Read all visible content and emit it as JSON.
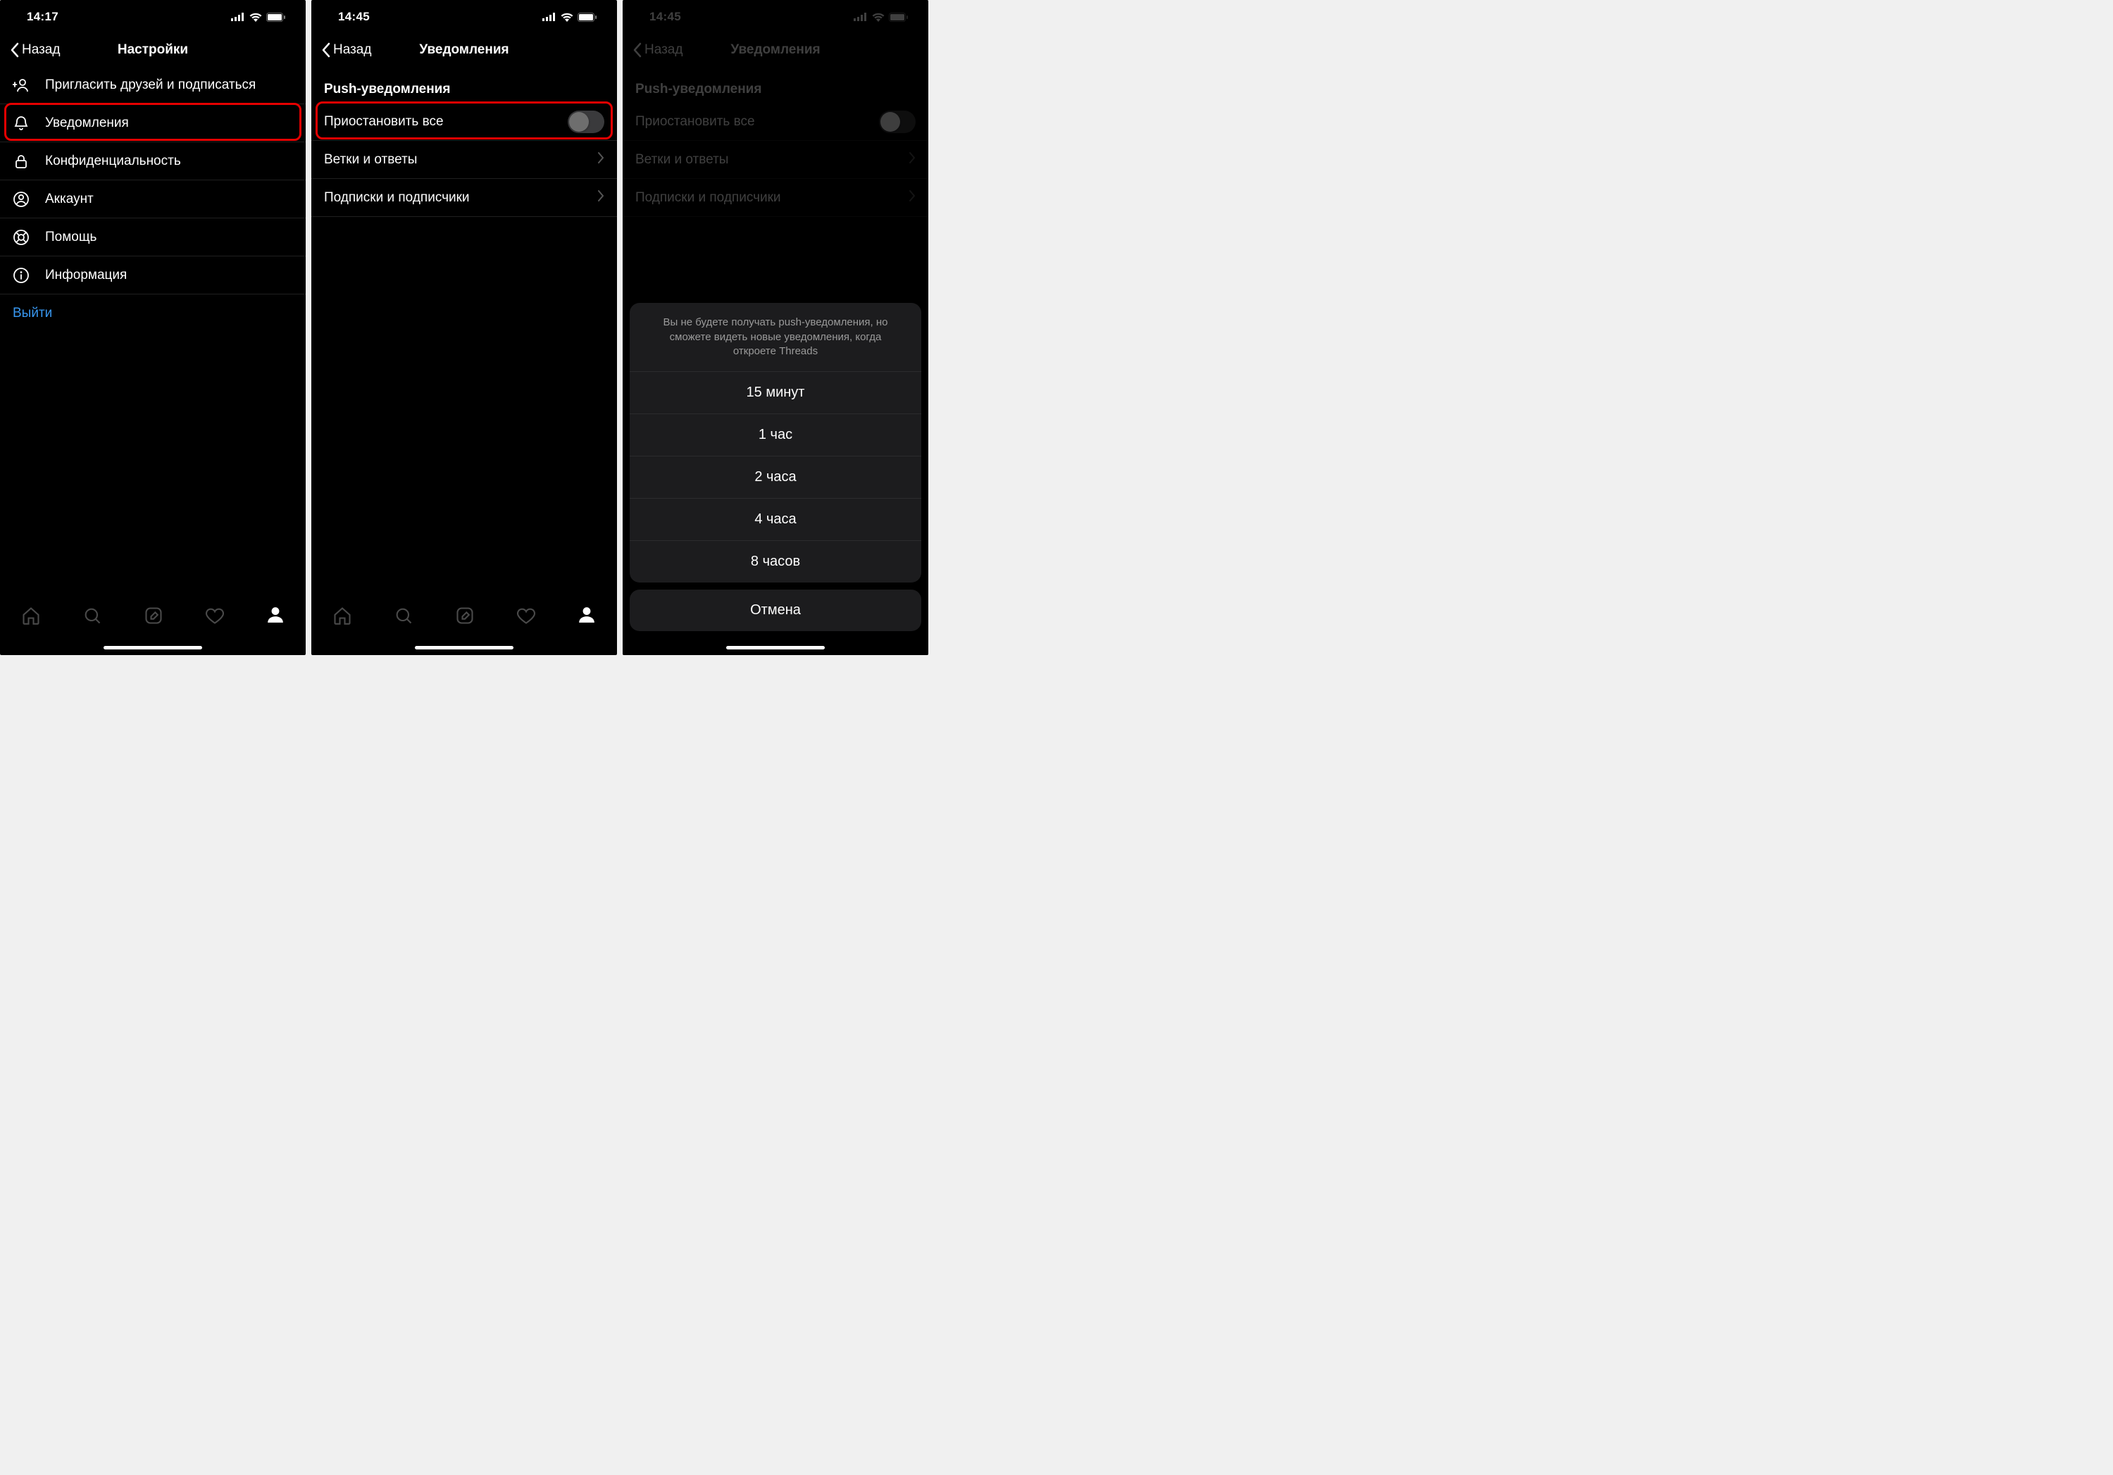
{
  "screens": [
    {
      "time": "14:17",
      "back": "Назад",
      "title": "Настройки",
      "items": [
        {
          "label": "Пригласить друзей и подписаться"
        },
        {
          "label": "Уведомления"
        },
        {
          "label": "Конфиденциальность"
        },
        {
          "label": "Аккаунт"
        },
        {
          "label": "Помощь"
        },
        {
          "label": "Информация"
        }
      ],
      "logout": "Выйти"
    },
    {
      "time": "14:45",
      "back": "Назад",
      "title": "Уведомления",
      "section": "Push-уведомления",
      "pause_all": "Приостановить все",
      "rows": [
        {
          "label": "Ветки и ответы"
        },
        {
          "label": "Подписки и подписчики"
        }
      ]
    },
    {
      "time": "14:45",
      "back": "Назад",
      "title": "Уведомления",
      "section": "Push-уведомления",
      "pause_all": "Приостановить все",
      "rows": [
        {
          "label": "Ветки и ответы"
        },
        {
          "label": "Подписки и подписчики"
        }
      ],
      "sheet": {
        "message": "Вы не будете получать push-уведомления, но сможете видеть новые уведомления, когда откроете Threads",
        "options": [
          "15 минут",
          "1 час",
          "2 часа",
          "4 часа",
          "8 часов"
        ],
        "cancel": "Отмена"
      }
    }
  ]
}
